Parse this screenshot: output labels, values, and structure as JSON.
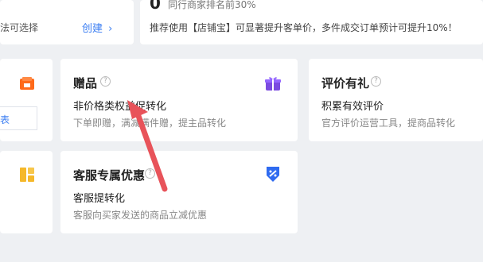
{
  "top_left_card": {
    "text": "法可选择",
    "create_link": "创建",
    "arrow": "chevron-right-icon"
  },
  "top_right_card": {
    "big_number": "0",
    "peer_rank": "同行商家排名前30%",
    "recommend": "推荐使用【店铺宝】可显著提升客单价，多件成交订单预计可提升10%！"
  },
  "tools": {
    "partial_link": "表",
    "gift": {
      "title": "赠品",
      "subtitle": "非价格类权益促转化",
      "desc": "下单即赠，满减满件赠，提主品转化",
      "help": "?"
    },
    "review": {
      "title": "评价有礼",
      "subtitle": "积累有效评价",
      "desc": "官方评价运营工具，提商品转化",
      "help": "?"
    },
    "service": {
      "title": "客服专属优惠",
      "subtitle": "客服提转化",
      "desc": "客服向买家发送的商品立减优惠",
      "help": "?"
    }
  },
  "colors": {
    "accent": "#3b7ef2",
    "orange": "#ff6a1a",
    "purple": "#7b4be0",
    "yellow": "#f5b82a",
    "blue": "#2f6bf0",
    "arrow": "#e8535a"
  }
}
